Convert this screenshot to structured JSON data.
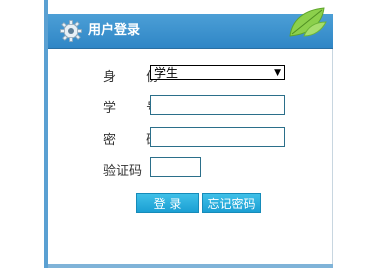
{
  "header": {
    "title": "用户登录",
    "accent_color": "#3a8fcd",
    "icons": [
      "gear-icon",
      "leaf-icon"
    ]
  },
  "form": {
    "identity_label": "身 份",
    "identity_value": "学生",
    "student_id_label": "学 号",
    "student_id_value": "",
    "password_label": "密 码",
    "password_value": "",
    "captcha_label": "验证码",
    "captcha_value": ""
  },
  "buttons": {
    "login_label": "登 录",
    "forgot_label": "忘记密码",
    "button_color": "#2aaede"
  }
}
